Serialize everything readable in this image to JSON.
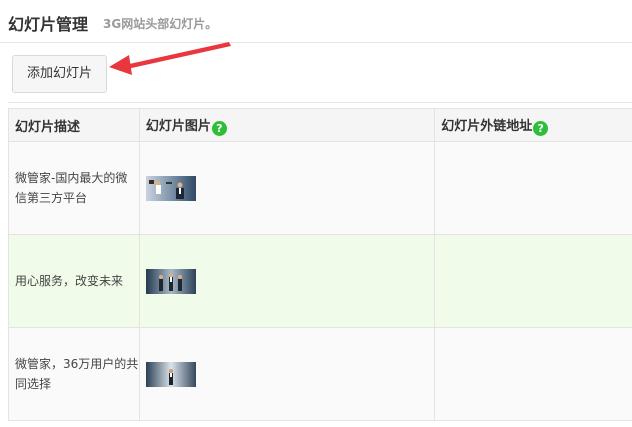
{
  "header": {
    "title": "幻灯片管理",
    "subtitle": "3G网站头部幻灯片。"
  },
  "toolbar": {
    "add_label": "添加幻灯片"
  },
  "table": {
    "columns": [
      {
        "label": "幻灯片描述",
        "help": false
      },
      {
        "label": "幻灯片图片",
        "help": true
      },
      {
        "label": "幻灯片外链地址",
        "help": true
      }
    ],
    "help_glyph": "?",
    "rows": [
      {
        "description": "微管家-国内最大的微信第三方平台",
        "image": "slide-thumbnail-1",
        "link": ""
      },
      {
        "description": "用心服务，改变未来",
        "image": "slide-thumbnail-2",
        "link": ""
      },
      {
        "description": "微管家，36万用户的共同选择",
        "image": "slide-thumbnail-3",
        "link": ""
      }
    ]
  },
  "colors": {
    "accent_arrow": "#e8383d",
    "help_icon": "#2dbe3a",
    "highlight_row": "#f0fbe9"
  }
}
